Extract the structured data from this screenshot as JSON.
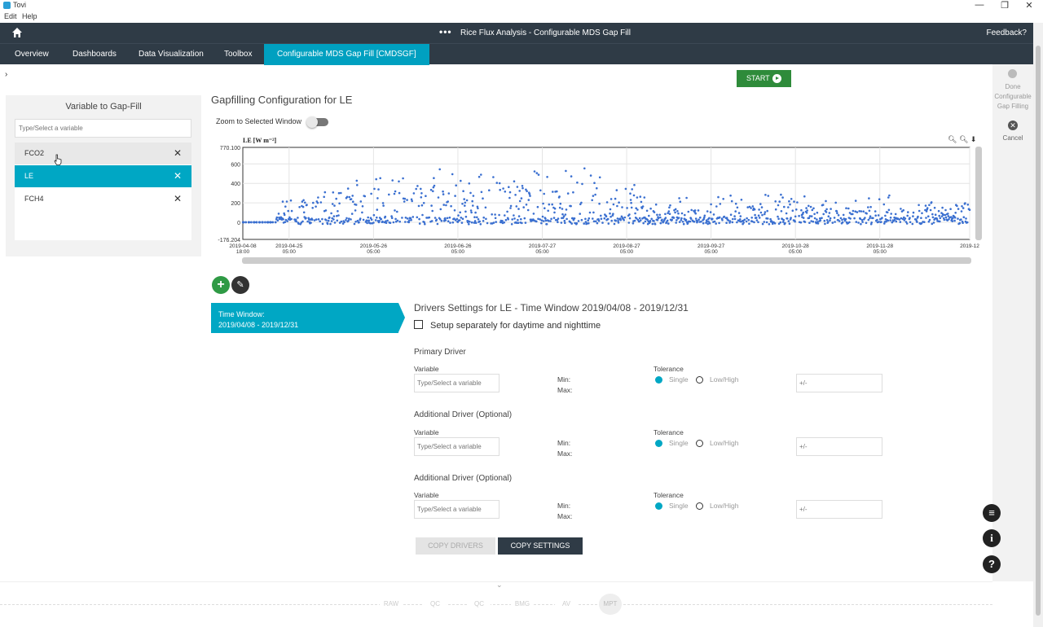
{
  "app": {
    "name": "Tovi"
  },
  "window_controls": {
    "minimize": "—",
    "restore": "❐",
    "close": "✕"
  },
  "menu": [
    "Edit",
    "Help"
  ],
  "header": {
    "dots": "•••",
    "title": "Rice Flux Analysis - Configurable MDS Gap Fill",
    "feedback": "Feedback?"
  },
  "nav": {
    "tabs": [
      "Overview",
      "Dashboards",
      "Data Visualization",
      "Toolbox",
      "Configurable MDS Gap Fill [CMDSGF]"
    ],
    "active_index": 4
  },
  "toolbar": {
    "expand": "›",
    "start_label": "START"
  },
  "right_panel": {
    "done_label": "Done Configurable Gap Filling",
    "cancel_label": "Cancel"
  },
  "variables_panel": {
    "heading": "Variable to Gap-Fill",
    "search_placeholder": "Type/Select a variable",
    "items": [
      {
        "label": "FCO2",
        "state": "hover"
      },
      {
        "label": "LE",
        "state": "active"
      },
      {
        "label": "FCH4",
        "state": "normal"
      }
    ],
    "remove_glyph": "✕"
  },
  "config": {
    "title": "Gapfilling Configuration for LE",
    "zoom_label": "Zoom to Selected Window",
    "zoom_enabled": false
  },
  "chart_data": {
    "type": "scatter",
    "ylabel": "LE [W m⁻²]",
    "ylim": [
      -176.204,
      770.1
    ],
    "y_ticks": [
      "770.100",
      "600",
      "400",
      "200",
      "0",
      "-176.204"
    ],
    "y_tick_values": [
      770.1,
      600,
      400,
      200,
      0,
      -176.204
    ],
    "x_ticks": [
      {
        "date": "2019-04-08",
        "time": "18:00"
      },
      {
        "date": "2019-04-25",
        "time": "05:00"
      },
      {
        "date": "2019-05-26",
        "time": "05:00"
      },
      {
        "date": "2019-06-26",
        "time": "05:00"
      },
      {
        "date": "2019-07-27",
        "time": "05:00"
      },
      {
        "date": "2019-08-27",
        "time": "05:00"
      },
      {
        "date": "2019-09-27",
        "time": "05:00"
      },
      {
        "date": "2019-10-28",
        "time": "05:00"
      },
      {
        "date": "2019-11-28",
        "time": "05:00"
      },
      {
        "date": "2019-12",
        "time": ""
      }
    ],
    "x_range": [
      "2019-04-08",
      "2019-12-31"
    ],
    "series_color": "#3a6fd0",
    "grid": true,
    "envelope": [
      {
        "date": "2019-04-08",
        "max": 0
      },
      {
        "date": "2019-04-25",
        "max": 300
      },
      {
        "date": "2019-05-10",
        "max": 400
      },
      {
        "date": "2019-05-26",
        "max": 550
      },
      {
        "date": "2019-06-10",
        "max": 580
      },
      {
        "date": "2019-06-26",
        "max": 590
      },
      {
        "date": "2019-07-10",
        "max": 590
      },
      {
        "date": "2019-07-27",
        "max": 580
      },
      {
        "date": "2019-08-10",
        "max": 610
      },
      {
        "date": "2019-08-27",
        "max": 470
      },
      {
        "date": "2019-09-10",
        "max": 280
      },
      {
        "date": "2019-09-27",
        "max": 250
      },
      {
        "date": "2019-10-10",
        "max": 380
      },
      {
        "date": "2019-10-28",
        "max": 330
      },
      {
        "date": "2019-11-10",
        "max": 260
      },
      {
        "date": "2019-11-28",
        "max": 300
      },
      {
        "date": "2019-12-31",
        "max": 240
      }
    ],
    "tools": [
      "zoom-in",
      "zoom-out",
      "download"
    ]
  },
  "time_window": {
    "label": "Time Window:",
    "range": "2019/04/08 - 2019/12/31"
  },
  "drivers": {
    "title": "Drivers Settings for LE - Time Window 2019/04/08 - 2019/12/31",
    "setup_label": "Setup separately for daytime and nighttime",
    "setup_checked": false,
    "sections": [
      {
        "title": "Primary Driver",
        "variable_label": "Variable",
        "variable_placeholder": "Type/Select a variable",
        "min_label": "Min:",
        "max_label": "Max:",
        "tolerance_label": "Tolerance",
        "single_label": "Single",
        "lowhigh_label": "Low/High",
        "tolerance_placeholder": "+/-"
      },
      {
        "title": "Additional Driver (Optional)",
        "variable_label": "Variable",
        "variable_placeholder": "Type/Select a variable",
        "min_label": "Min:",
        "max_label": "Max:",
        "tolerance_label": "Tolerance",
        "single_label": "Single",
        "lowhigh_label": "Low/High",
        "tolerance_placeholder": "+/-"
      },
      {
        "title": "Additional Driver (Optional)",
        "variable_label": "Variable",
        "variable_placeholder": "Type/Select a variable",
        "min_label": "Min:",
        "max_label": "Max:",
        "tolerance_label": "Tolerance",
        "single_label": "Single",
        "lowhigh_label": "Low/High",
        "tolerance_placeholder": "+/-"
      }
    ],
    "copy_drivers": "COPY DRIVERS",
    "copy_settings": "COPY SETTINGS"
  },
  "side_icons": {
    "notes": "≡",
    "info": "i",
    "help": "?"
  },
  "bottom": {
    "chevron": "⌄",
    "pipeline": [
      "RAW",
      "QC",
      "QC",
      "BMG",
      "AV",
      "MPT"
    ],
    "current": "MPT"
  }
}
